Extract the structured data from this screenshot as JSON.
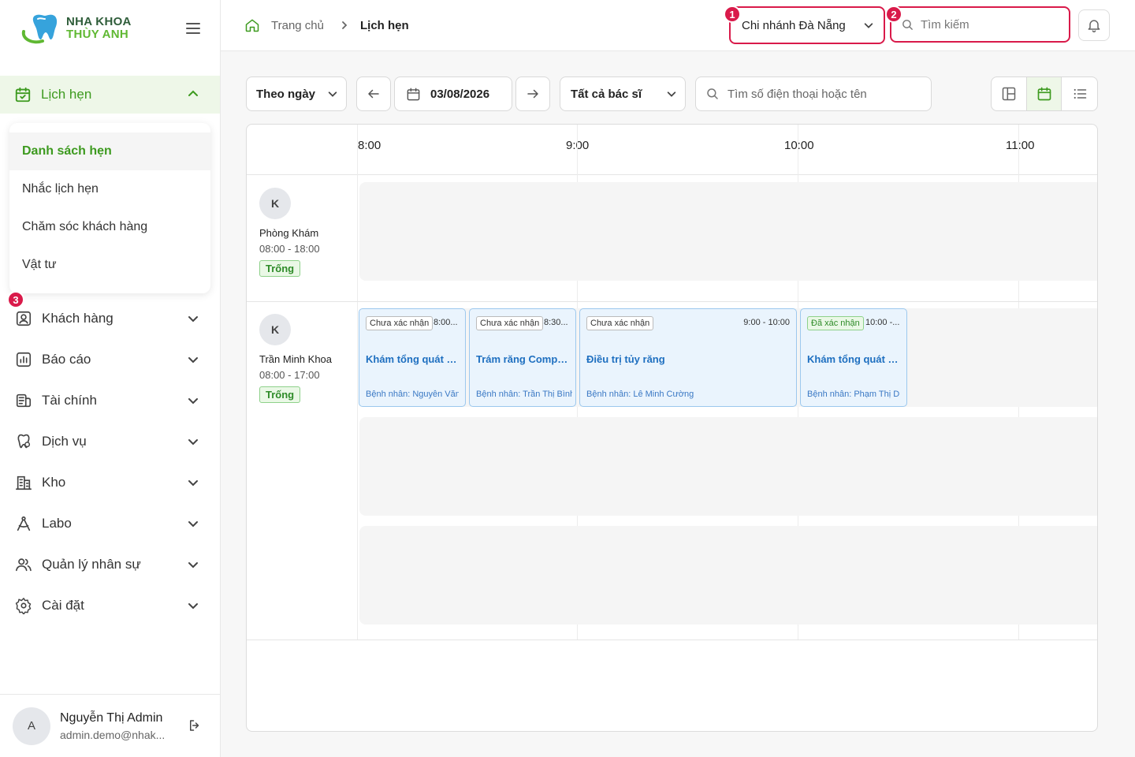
{
  "brand": {
    "line1": "NHA KHOA",
    "line2": "THÙY ANH"
  },
  "sidebar": {
    "active": {
      "label": "Lịch hẹn"
    },
    "submenu": [
      "Danh sách hẹn",
      "Nhắc lịch hẹn",
      "Chăm sóc khách hàng",
      "Vật tư"
    ],
    "items": [
      {
        "label": "Khách hàng",
        "icon": "user-icon"
      },
      {
        "label": "Báo cáo",
        "icon": "report-icon"
      },
      {
        "label": "Tài chính",
        "icon": "finance-icon"
      },
      {
        "label": "Dịch vụ",
        "icon": "tooth-service-icon"
      },
      {
        "label": "Kho",
        "icon": "warehouse-icon"
      },
      {
        "label": "Labo",
        "icon": "labo-icon"
      },
      {
        "label": "Quản lý nhân sự",
        "icon": "staff-icon"
      },
      {
        "label": "Cài đặt",
        "icon": "settings-icon"
      }
    ]
  },
  "user": {
    "initial": "A",
    "name": "Nguyễn Thị Admin",
    "email": "admin.demo@nhak..."
  },
  "header": {
    "crumb_home": "Trang chủ",
    "crumb_current": "Lịch hẹn",
    "branch": "Chi nhánh Đà Nẵng",
    "search_placeholder": "Tìm kiếm"
  },
  "markers": [
    "1",
    "2",
    "3"
  ],
  "toolbar": {
    "view_mode": "Theo ngày",
    "date": "03/08/2026",
    "doctor": "Tất cả bác sĩ",
    "search_placeholder": "Tìm số điện thoại hoặc tên"
  },
  "calendar": {
    "times": [
      "8:00",
      "9:00",
      "10:00",
      "11:00"
    ],
    "resources": [
      {
        "initial": "K",
        "name": "Phòng Khám",
        "hours": "08:00 - 18:00",
        "tag": "Trống"
      },
      {
        "initial": "K",
        "name": "Trần Minh Khoa",
        "hours": "08:00 - 17:00",
        "tag": "Trống"
      }
    ],
    "appointments": [
      {
        "status": "Chưa xác nhận",
        "time": "8:00...",
        "title": "Khám tổng quát & ...",
        "patient": "Bệnh nhân: Nguyễn Văn"
      },
      {
        "status": "Chưa xác nhận",
        "time": "8:30...",
        "title": "Trám răng Compo...",
        "patient": "Bệnh nhân: Trần Thị Bình"
      },
      {
        "status": "Chưa xác nhận",
        "time": "9:00 - 10:00",
        "title": "Điều trị tủy răng",
        "patient": "Bệnh nhân: Lê Minh Cường"
      },
      {
        "status": "Đã xác nhận",
        "time": "10:00 -...",
        "title": "Khám tổng quát & ...",
        "patient": "Bệnh nhân: Phạm Thị Du"
      }
    ]
  },
  "colors": {
    "primary": "#3d9a1f",
    "highlight": "#d91a4a",
    "appointment_bg": "#eaf4fd"
  }
}
